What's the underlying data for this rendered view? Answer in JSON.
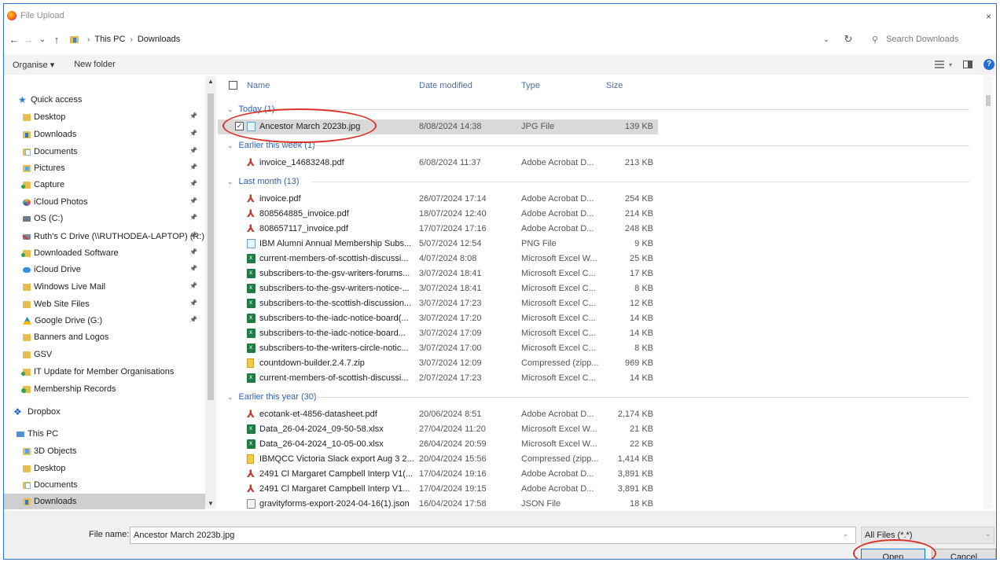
{
  "window": {
    "title": "File Upload",
    "close": "×"
  },
  "nav": {
    "back": "←",
    "forward": "→",
    "recent": "⌄",
    "up": "↑",
    "breadcrumb": [
      "This PC",
      "Downloads"
    ],
    "search_placeholder": "Search Downloads"
  },
  "toolbar": {
    "organise": "Organise ▾",
    "new_folder": "New folder"
  },
  "sidebar": {
    "items": [
      {
        "label": "Quick access",
        "icon": "star"
      },
      {
        "label": "Desktop",
        "icon": "folder",
        "pinned": true
      },
      {
        "label": "Downloads",
        "icon": "folder-dl",
        "pinned": true
      },
      {
        "label": "Documents",
        "icon": "folder-doc",
        "pinned": true
      },
      {
        "label": "Pictures",
        "icon": "folder-pic",
        "pinned": true
      },
      {
        "label": "Capture",
        "icon": "folder-green",
        "pinned": true
      },
      {
        "label": "iCloud Photos",
        "icon": "icloudphotos",
        "pinned": true
      },
      {
        "label": "OS (C:)",
        "icon": "drive",
        "pinned": true
      },
      {
        "label": "Ruth's C Drive (\\\\RUTHODEA-LAPTOP) (R:)",
        "icon": "netdrive",
        "pinned": true
      },
      {
        "label": "Downloaded Software",
        "icon": "folder-green",
        "pinned": true
      },
      {
        "label": "iCloud Drive",
        "icon": "cloud",
        "pinned": true
      },
      {
        "label": "Windows Live Mail",
        "icon": "mail",
        "pinned": true
      },
      {
        "label": "Web Site Files",
        "icon": "folder",
        "pinned": true
      },
      {
        "label": "Google Drive (G:)",
        "icon": "gdrive",
        "pinned": true
      },
      {
        "label": "Banners and Logos",
        "icon": "folder"
      },
      {
        "label": "GSV",
        "icon": "folder"
      },
      {
        "label": "IT Update for Member Organisations",
        "icon": "folder-green"
      },
      {
        "label": "Membership Records",
        "icon": "people"
      },
      {
        "label": "Dropbox",
        "icon": "dropbox"
      },
      {
        "label": "This PC",
        "icon": "thispc"
      },
      {
        "label": "3D Objects",
        "icon": "obj3d"
      },
      {
        "label": "Desktop",
        "icon": "folder"
      },
      {
        "label": "Documents",
        "icon": "folder-doc"
      },
      {
        "label": "Downloads",
        "icon": "folder-dl",
        "selected": true
      }
    ]
  },
  "columns": {
    "name": "Name",
    "date": "Date modified",
    "type": "Type",
    "size": "Size"
  },
  "groups": [
    {
      "label": "Today (1)",
      "files": [
        {
          "name": "Ancestor March 2023b.jpg",
          "date": "8/08/2024 14:38",
          "type": "JPG File",
          "size": "139 KB",
          "icon": "jpg",
          "selected": true
        }
      ]
    },
    {
      "label": "Earlier this week (1)",
      "files": [
        {
          "name": "invoice_14683248.pdf",
          "date": "6/08/2024 11:37",
          "type": "Adobe Acrobat D...",
          "size": "213 KB",
          "icon": "pdf"
        }
      ]
    },
    {
      "label": "Last month (13)",
      "files": [
        {
          "name": "invoice.pdf",
          "date": "26/07/2024 17:14",
          "type": "Adobe Acrobat D...",
          "size": "254 KB",
          "icon": "pdf"
        },
        {
          "name": "808564885_invoice.pdf",
          "date": "18/07/2024 12:40",
          "type": "Adobe Acrobat D...",
          "size": "214 KB",
          "icon": "pdf"
        },
        {
          "name": "808657117_invoice.pdf",
          "date": "17/07/2024 17:16",
          "type": "Adobe Acrobat D...",
          "size": "248 KB",
          "icon": "pdf"
        },
        {
          "name": "IBM Alumni Annual Membership Subs...",
          "date": "5/07/2024 12:54",
          "type": "PNG File",
          "size": "9 KB",
          "icon": "png"
        },
        {
          "name": "current-members-of-scottish-discussi...",
          "date": "4/07/2024 8:08",
          "type": "Microsoft Excel W...",
          "size": "25 KB",
          "icon": "xls"
        },
        {
          "name": "subscribers-to-the-gsv-writers-forums...",
          "date": "3/07/2024 18:41",
          "type": "Microsoft Excel C...",
          "size": "17 KB",
          "icon": "xls"
        },
        {
          "name": "subscribers-to-the-gsv-writers-notice-...",
          "date": "3/07/2024 18:41",
          "type": "Microsoft Excel C...",
          "size": "8 KB",
          "icon": "xls"
        },
        {
          "name": "subscribers-to-the-scottish-discussion...",
          "date": "3/07/2024 17:23",
          "type": "Microsoft Excel C...",
          "size": "12 KB",
          "icon": "xls"
        },
        {
          "name": "subscribers-to-the-iadc-notice-board(...",
          "date": "3/07/2024 17:20",
          "type": "Microsoft Excel C...",
          "size": "14 KB",
          "icon": "xls"
        },
        {
          "name": "subscribers-to-the-iadc-notice-board...",
          "date": "3/07/2024 17:09",
          "type": "Microsoft Excel C...",
          "size": "14 KB",
          "icon": "xls"
        },
        {
          "name": "subscribers-to-the-writers-circle-notic...",
          "date": "3/07/2024 17:00",
          "type": "Microsoft Excel C...",
          "size": "8 KB",
          "icon": "xls"
        },
        {
          "name": "countdown-builder.2.4.7.zip",
          "date": "3/07/2024 12:09",
          "type": "Compressed (zipp...",
          "size": "969 KB",
          "icon": "zip"
        },
        {
          "name": "current-members-of-scottish-discussi...",
          "date": "2/07/2024 17:23",
          "type": "Microsoft Excel C...",
          "size": "14 KB",
          "icon": "xls"
        }
      ]
    },
    {
      "label": "Earlier this year (30)",
      "files": [
        {
          "name": "ecotank-et-4856-datasheet.pdf",
          "date": "20/06/2024 8:51",
          "type": "Adobe Acrobat D...",
          "size": "2,174 KB",
          "icon": "pdf"
        },
        {
          "name": "Data_26-04-2024_09-50-58.xlsx",
          "date": "27/04/2024 11:20",
          "type": "Microsoft Excel W...",
          "size": "21 KB",
          "icon": "xls"
        },
        {
          "name": "Data_26-04-2024_10-05-00.xlsx",
          "date": "26/04/2024 20:59",
          "type": "Microsoft Excel W...",
          "size": "22 KB",
          "icon": "xls"
        },
        {
          "name": "IBMQCC Victoria Slack export Aug 3 2...",
          "date": "20/04/2024 15:56",
          "type": "Compressed (zipp...",
          "size": "1,414 KB",
          "icon": "zip"
        },
        {
          "name": "2491 Cl Margaret Campbell Interp V1(...",
          "date": "17/04/2024 19:16",
          "type": "Adobe Acrobat D...",
          "size": "3,891 KB",
          "icon": "pdf"
        },
        {
          "name": "2491 Cl Margaret Campbell Interp V1...",
          "date": "17/04/2024 19:15",
          "type": "Adobe Acrobat D...",
          "size": "3,891 KB",
          "icon": "pdf"
        },
        {
          "name": "gravityforms-export-2024-04-16(1).json",
          "date": "16/04/2024 17:58",
          "type": "JSON File",
          "size": "18 KB",
          "icon": "json"
        }
      ]
    }
  ],
  "footer": {
    "file_name_label": "File name:",
    "file_name_value": "Ancestor March 2023b.jpg",
    "filter": "All Files (*.*)",
    "open": "Open",
    "cancel": "Cancel"
  },
  "colors": {
    "accent": "#2f62b8",
    "highlight_ring": "#d9342b",
    "selection": "#d9d9d9"
  }
}
